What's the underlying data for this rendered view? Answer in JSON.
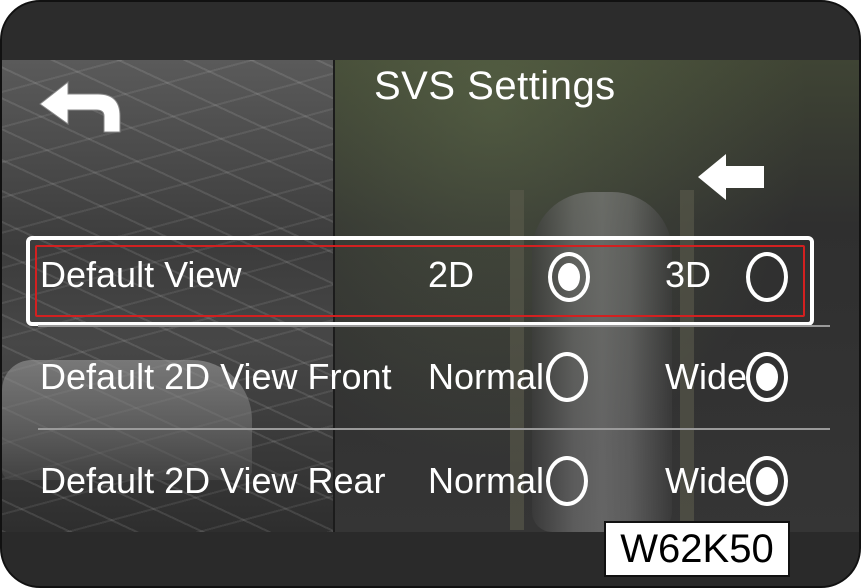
{
  "screen": {
    "title": "SVS Settings"
  },
  "icons": {
    "back": "back-arrow-icon",
    "direction": "left-arrow-icon",
    "radio_selected": "radio-selected-icon",
    "radio_unselected": "radio-unselected-icon"
  },
  "settings": [
    {
      "label": "Default View",
      "options": [
        {
          "label": "2D",
          "selected": true
        },
        {
          "label": "3D",
          "selected": false
        }
      ],
      "highlighted": true
    },
    {
      "label": "Default 2D View Front",
      "options": [
        {
          "label": "Normal",
          "selected": false
        },
        {
          "label": "Wide",
          "selected": true
        }
      ],
      "highlighted": false
    },
    {
      "label": "Default 2D View Rear",
      "options": [
        {
          "label": "Normal",
          "selected": false
        },
        {
          "label": "Wide",
          "selected": true
        }
      ],
      "highlighted": false
    }
  ],
  "figure_code": "W62K50",
  "colors": {
    "highlight_outer": "#ffffff",
    "highlight_inner": "#d32020",
    "text": "#ffffff"
  }
}
